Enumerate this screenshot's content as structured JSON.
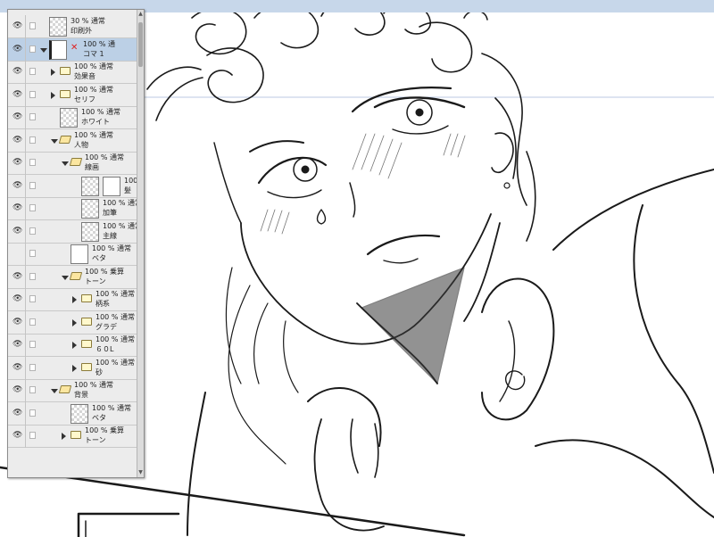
{
  "artwork": {
    "subject": "manga line art of a curly-haired character with hand near collar"
  },
  "layer_panel": {
    "layers": [
      {
        "indent": 0,
        "kind": "raster",
        "mode": "30 % 通常",
        "name": "印刷外",
        "visible": true,
        "expand": ""
      },
      {
        "indent": 0,
        "kind": "frame",
        "mode": "100 % 通",
        "name": "コマ 1",
        "visible": true,
        "expand": "down",
        "selected": true
      },
      {
        "indent": 1,
        "kind": "folder",
        "mode": "100 % 通常",
        "name": "効果音",
        "visible": true,
        "expand": "right"
      },
      {
        "indent": 1,
        "kind": "folder",
        "mode": "100 % 通常",
        "name": "セリフ",
        "visible": true,
        "expand": "right"
      },
      {
        "indent": 1,
        "kind": "raster",
        "mode": "100 % 通常",
        "name": "ホワイト",
        "visible": true,
        "expand": ""
      },
      {
        "indent": 1,
        "kind": "folder-open",
        "mode": "100 % 通常",
        "name": "人物",
        "visible": true,
        "expand": "down"
      },
      {
        "indent": 2,
        "kind": "folder-open",
        "mode": "100 % 通常",
        "name": "線画",
        "visible": true,
        "expand": "down"
      },
      {
        "indent": 3,
        "kind": "raster-mask",
        "mode": "100 %",
        "name": "髪",
        "visible": true,
        "expand": ""
      },
      {
        "indent": 3,
        "kind": "raster",
        "mode": "100 % 通常",
        "name": "加筆",
        "visible": true,
        "expand": ""
      },
      {
        "indent": 3,
        "kind": "raster",
        "mode": "100 % 通常",
        "name": "主線",
        "visible": true,
        "expand": ""
      },
      {
        "indent": 2,
        "kind": "raster-white",
        "mode": "100 % 通常",
        "name": "ベタ",
        "visible": false,
        "expand": ""
      },
      {
        "indent": 2,
        "kind": "folder-open",
        "mode": "100 % 乗算",
        "name": "トーン",
        "visible": true,
        "expand": "down"
      },
      {
        "indent": 3,
        "kind": "folder",
        "mode": "100 % 通常",
        "name": "柄系",
        "visible": true,
        "expand": "right"
      },
      {
        "indent": 3,
        "kind": "folder",
        "mode": "100 % 通常",
        "name": "グラデ",
        "visible": true,
        "expand": "right"
      },
      {
        "indent": 3,
        "kind": "folder",
        "mode": "100 % 通常",
        "name": "６０L",
        "visible": true,
        "expand": "right"
      },
      {
        "indent": 3,
        "kind": "folder",
        "mode": "100 % 通常",
        "name": "砂",
        "visible": true,
        "expand": "right"
      },
      {
        "indent": 1,
        "kind": "folder-open",
        "mode": "100 % 通常",
        "name": "背景",
        "visible": true,
        "expand": "down"
      },
      {
        "indent": 2,
        "kind": "raster",
        "mode": "100 % 通常",
        "name": "ベタ",
        "visible": true,
        "expand": ""
      },
      {
        "indent": 2,
        "kind": "folder",
        "mode": "100 % 乗算",
        "name": "トーン",
        "visible": true,
        "expand": "right"
      }
    ]
  }
}
